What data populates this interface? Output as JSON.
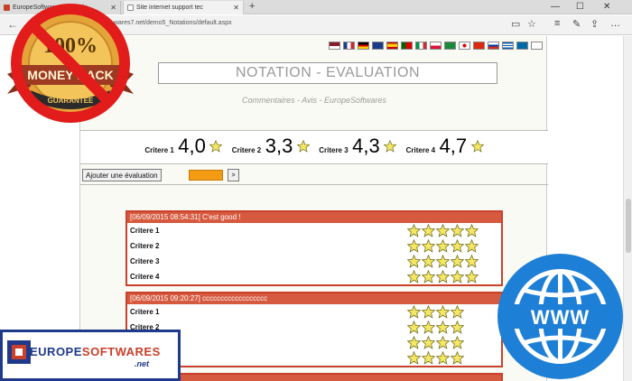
{
  "browser": {
    "tabs": [
      {
        "label": "EuropeSoftwares by Eagle...",
        "active": false
      },
      {
        "label": "Site internet support tec",
        "active": true
      }
    ],
    "url": "...wares7.net/demo5_Notations/default.aspx"
  },
  "page": {
    "title": "NOTATION - EVALUATION",
    "subtitle": "Commentaires - Avis - EuropeSoftwares",
    "criteria": [
      {
        "label": "Critere 1",
        "value": "4,0"
      },
      {
        "label": "Critere 2",
        "value": "3,3"
      },
      {
        "label": "Critere 3",
        "value": "4,3"
      },
      {
        "label": "Critere 4",
        "value": "4,7"
      }
    ],
    "add_button": "Ajouter une évaluation",
    "go_button": ">",
    "reviews": [
      {
        "header": "[06/09/2015 08:54:31] C'est good !",
        "rows": [
          {
            "label": "Critere 1",
            "stars": 5
          },
          {
            "label": "Critere 2",
            "stars": 5
          },
          {
            "label": "Critere 3",
            "stars": 5
          },
          {
            "label": "Critere 4",
            "stars": 5
          }
        ]
      },
      {
        "header": "[06/09/2015 09:20:27] cccccccccccccccccc",
        "rows": [
          {
            "label": "Critere 1",
            "stars": 4
          },
          {
            "label": "Critere 2",
            "stars": 4
          },
          {
            "label": "",
            "stars": 4
          },
          {
            "label": "",
            "stars": 4
          }
        ]
      },
      {
        "header": "",
        "rows": []
      }
    ]
  },
  "overlays": {
    "money_back_top": "100%",
    "money_back_main": "MONEY BACK",
    "money_back_ribbon": "GUARANTEE",
    "logo_europe": "EUROPE",
    "logo_softwares": "SOFTWARES",
    "logo_net": ".net",
    "www_text": "WWW"
  },
  "colors": {
    "accent_orange": "#f39b12",
    "review_border": "#c9412a",
    "star_fill": "#f5e663",
    "www_blue": "#1e7fd6"
  }
}
